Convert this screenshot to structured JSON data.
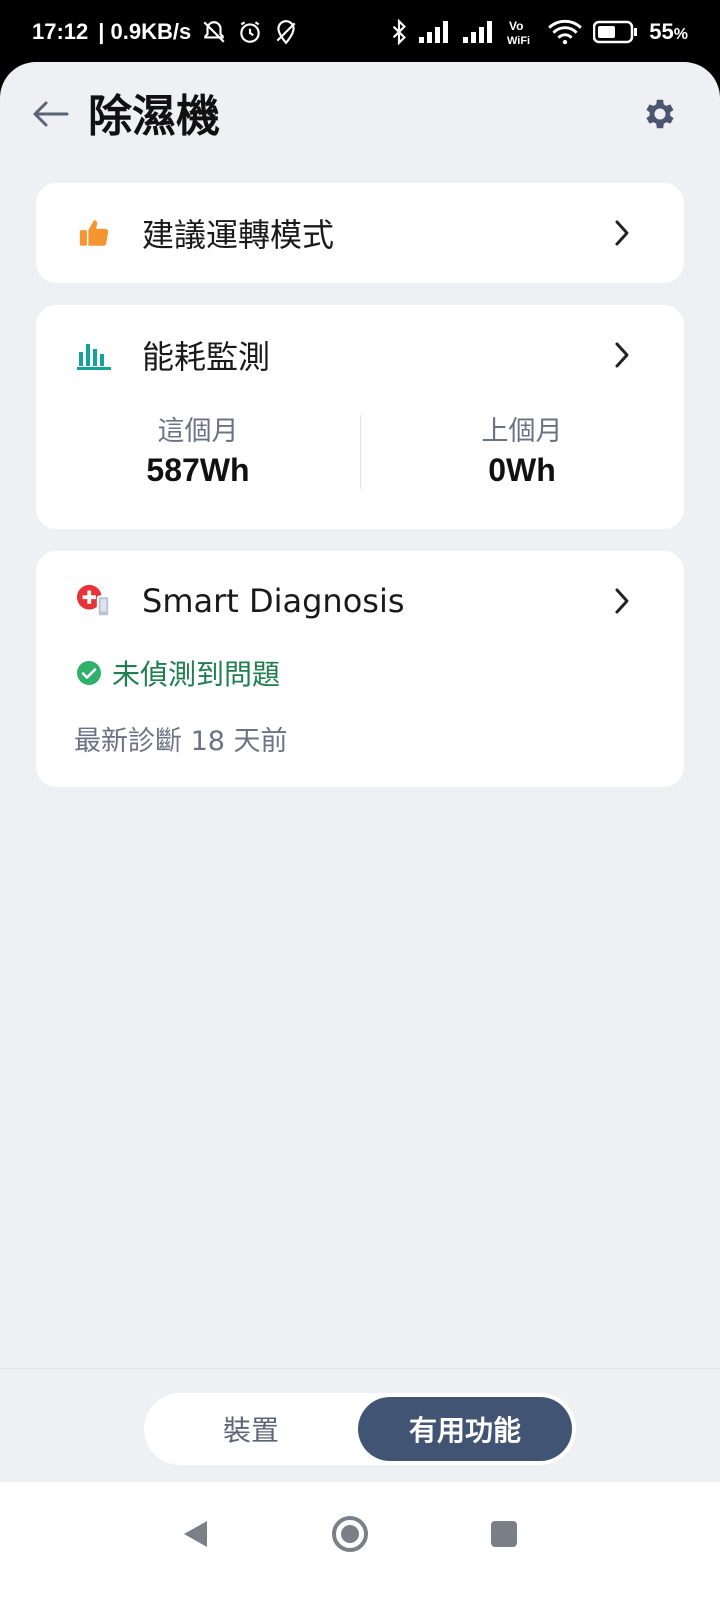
{
  "status_bar": {
    "time": "17:12",
    "network_speed": "| 0.9KB/s",
    "battery_percent": "55",
    "battery_unit": "%"
  },
  "header": {
    "title": "除濕機"
  },
  "cards": {
    "recommended_mode": {
      "label": "建議運轉模式"
    },
    "energy": {
      "label": "能耗監測",
      "this_month_label": "這個月",
      "this_month_value": "587Wh",
      "last_month_label": "上個月",
      "last_month_value": "0Wh"
    },
    "diagnosis": {
      "label": "Smart Diagnosis",
      "status": "未偵測到問題",
      "last_diagnosis": "最新診斷 18 天前"
    }
  },
  "bottom_tabs": {
    "device": "裝置",
    "features": "有用功能"
  },
  "colors": {
    "background": "#eff0f4",
    "card": "#ffffff",
    "accent": "#415474",
    "success": "#1e7e4f",
    "energy_icon": "#12a39a",
    "thumb_icon": "#f59530",
    "diagnosis_icon": "#e6343a"
  }
}
